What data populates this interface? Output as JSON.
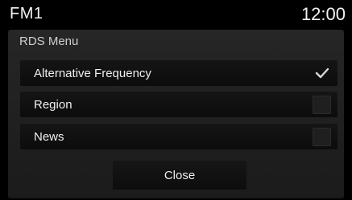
{
  "status_bar": {
    "source": "FM1",
    "clock": "12:00"
  },
  "dialog": {
    "title": "RDS Menu",
    "items": [
      {
        "label": "Alternative Frequency",
        "checked": true
      },
      {
        "label": "Region",
        "checked": false
      },
      {
        "label": "News",
        "checked": false
      }
    ],
    "close_label": "Close"
  },
  "colors": {
    "background": "#000000",
    "panel": "#222222",
    "row": "#111111",
    "text": "#efefef",
    "checkmark": "#d8d8d8"
  },
  "icons": {
    "check": "check-icon"
  }
}
